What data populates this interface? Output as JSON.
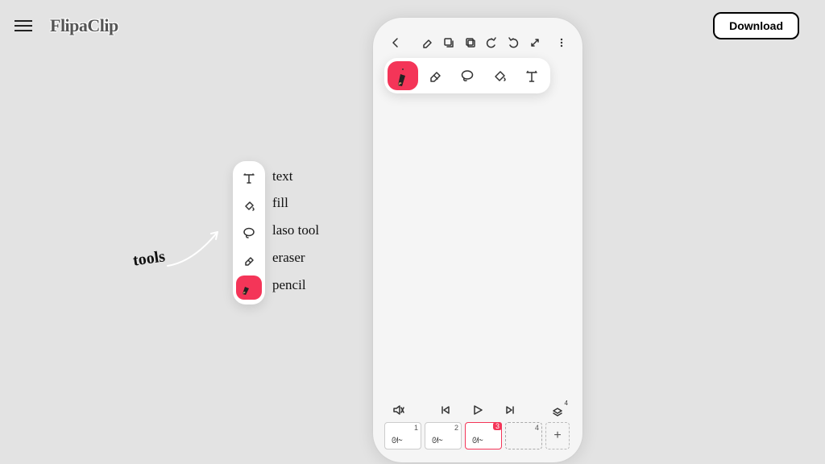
{
  "header": {
    "logo_text": "FlipaClip",
    "download_label": "Download"
  },
  "annotations": {
    "tools_label": "tools",
    "labels": {
      "text": "text",
      "fill": "fill",
      "laso": "laso tool",
      "eraser": "eraser",
      "pencil": "pencil"
    }
  },
  "vertical_tools": [
    {
      "name": "text",
      "active": false
    },
    {
      "name": "fill",
      "active": false
    },
    {
      "name": "laso",
      "active": false
    },
    {
      "name": "eraser",
      "active": false
    },
    {
      "name": "pencil",
      "active": true
    }
  ],
  "horizontal_tools": [
    {
      "name": "pencil",
      "active": true
    },
    {
      "name": "eraser",
      "active": false
    },
    {
      "name": "laso",
      "active": false
    },
    {
      "name": "fill",
      "active": false
    },
    {
      "name": "text",
      "active": false
    }
  ],
  "frames": [
    {
      "num": "1",
      "selected": false
    },
    {
      "num": "2",
      "selected": false
    },
    {
      "num": "3",
      "selected": true
    },
    {
      "num": "4",
      "selected": false,
      "empty": true
    }
  ],
  "layers_count": "4"
}
